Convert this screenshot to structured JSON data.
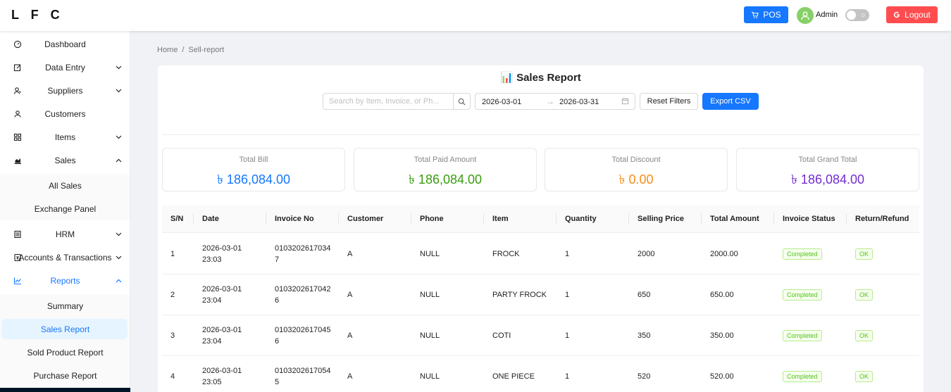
{
  "header": {
    "logo": "L F C",
    "pos_label": "POS",
    "admin_label": "Admin",
    "logout_label": "Logout"
  },
  "sidebar": {
    "items": [
      {
        "label": "Dashboard",
        "icon": "dashboard-icon"
      },
      {
        "label": "Data Entry",
        "icon": "edit-icon",
        "chevron": "down"
      },
      {
        "label": "Suppliers",
        "icon": "users-icon",
        "chevron": "down"
      },
      {
        "label": "Customers",
        "icon": "user-icon"
      },
      {
        "label": "Items",
        "icon": "appstore-icon",
        "chevron": "down"
      },
      {
        "label": "Sales",
        "icon": "chart-icon",
        "chevron": "up"
      },
      {
        "label": "All Sales",
        "sub": true
      },
      {
        "label": "Exchange Panel",
        "sub": true
      },
      {
        "label": "HRM",
        "icon": "hrm-icon",
        "chevron": "down"
      },
      {
        "label": "Accounts & Transactions",
        "icon": "account-book-icon",
        "chevron": "down"
      },
      {
        "label": "Reports",
        "icon": "line-chart-icon",
        "chevron": "up",
        "active": true
      },
      {
        "label": "Summary",
        "sub": true
      },
      {
        "label": "Sales Report",
        "sub": true,
        "selected": true
      },
      {
        "label": "Sold Product Report",
        "sub": true
      },
      {
        "label": "Purchase Report",
        "sub": true
      }
    ]
  },
  "breadcrumb": {
    "home": "Home",
    "separator": "/",
    "current": "Sell-report"
  },
  "report": {
    "title_icon": "📊",
    "title": "Sales Report",
    "search_placeholder": "Search by Item, Invoice, or Ph...",
    "date_start": "2026-03-01",
    "date_end": "2026-03-31",
    "reset_label": "Reset Filters",
    "export_label": "Export CSV"
  },
  "stats": [
    {
      "title": "Total Bill",
      "value": "৳ 186,084.00",
      "color": "#1677ff"
    },
    {
      "title": "Total Paid Amount",
      "value": "৳ 186,084.00",
      "color": "#389e0d"
    },
    {
      "title": "Total Discount",
      "value": "৳ 0.00",
      "color": "#fa8c16"
    },
    {
      "title": "Total Grand Total",
      "value": "৳ 186,084.00",
      "color": "#722ed1"
    }
  ],
  "table": {
    "columns": [
      "S/N",
      "Date",
      "Invoice No",
      "Customer",
      "Phone",
      "Item",
      "Quantity",
      "Selling Price",
      "Total Amount",
      "Invoice Status",
      "Return/Refund"
    ],
    "rows": [
      {
        "sn": "1",
        "date1": "2026-03-01",
        "date2": "23:03",
        "inv1": "0103202617034",
        "inv2": "7",
        "customer": "A",
        "phone": "NULL",
        "item": "FROCK",
        "qty": "1",
        "price": "2000",
        "total": "2000.00",
        "status": "Completed",
        "refund": "OK"
      },
      {
        "sn": "2",
        "date1": "2026-03-01",
        "date2": "23:04",
        "inv1": "0103202617042",
        "inv2": "6",
        "customer": "A",
        "phone": "NULL",
        "item": "PARTY FROCK",
        "qty": "1",
        "price": "650",
        "total": "650.00",
        "status": "Completed",
        "refund": "OK"
      },
      {
        "sn": "3",
        "date1": "2026-03-01",
        "date2": "23:04",
        "inv1": "0103202617045",
        "inv2": "6",
        "customer": "A",
        "phone": "NULL",
        "item": "COTI",
        "qty": "1",
        "price": "350",
        "total": "350.00",
        "status": "Completed",
        "refund": "OK"
      },
      {
        "sn": "4",
        "date1": "2026-03-01",
        "date2": "23:05",
        "inv1": "0103202617054",
        "inv2": "5",
        "customer": "A",
        "phone": "NULL",
        "item": "ONE PIECE",
        "qty": "1",
        "price": "520",
        "total": "520.00",
        "status": "Completed",
        "refund": "OK"
      }
    ]
  },
  "colors": {
    "primary": "#1677ff",
    "danger": "#ff4d4f",
    "success": "#52c41a"
  }
}
